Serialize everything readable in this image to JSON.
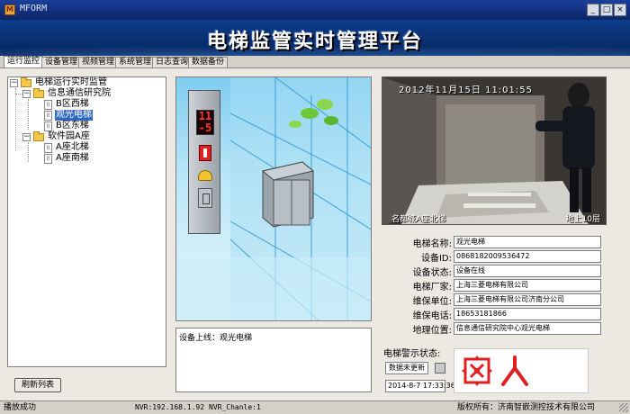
{
  "window": {
    "title": "MFORM",
    "buttons": [
      "_",
      "□",
      "×"
    ]
  },
  "banner": {
    "title": "电梯监管实时管理平台"
  },
  "tabs": [
    {
      "label": "运行监控",
      "active": true
    },
    {
      "label": "设备管理"
    },
    {
      "label": "视频管理"
    },
    {
      "label": "系统管理"
    },
    {
      "label": "日志查询"
    },
    {
      "label": "数据备份"
    }
  ],
  "tree": {
    "root": "电梯运行实时监管",
    "groups": [
      {
        "label": "信息通信研究院",
        "items": [
          "B区西梯",
          "观光电梯",
          "B区东梯"
        ]
      },
      {
        "label": "软件园A座",
        "items": [
          "A座北梯",
          "A座南梯"
        ]
      }
    ],
    "selected": "观光电梯"
  },
  "refresh_button": "刷新列表",
  "elevator_panel": {
    "floor_display": "11\n-5"
  },
  "camera": {
    "timestamp": "2012年11月15日  11:01:55",
    "label_left": "名都城A座北梯",
    "label_right": "地上10层"
  },
  "info": {
    "fields": [
      {
        "label": "电梯名称:",
        "value": "观光电梯"
      },
      {
        "label": "设备ID:",
        "value": "0868182009536472"
      },
      {
        "label": "设备状态:",
        "value": "设备在线"
      },
      {
        "label": "电梯厂家:",
        "value": "上海三菱电梯有限公司"
      },
      {
        "label": "维保单位:",
        "value": "上海三菱电梯有限公司济南分公司"
      },
      {
        "label": "维保电话:",
        "value": "18653181866"
      },
      {
        "label": "地理位置:",
        "value": "信息通信研究院中心观光电梯"
      }
    ]
  },
  "log": {
    "text": "设备上线：观光电梯"
  },
  "alert": {
    "title": "电梯警示状态:",
    "status": "数据未更新",
    "time": "2014-8-7 17:33:36",
    "icon_color": "#e02020"
  },
  "statusbar": {
    "status": "播放成功",
    "nvr": "NVR:192.168.1.92",
    "channel": "NVR_Chanle:1",
    "copyright": "版权所有：济南智嵌测控技术有限公司"
  }
}
